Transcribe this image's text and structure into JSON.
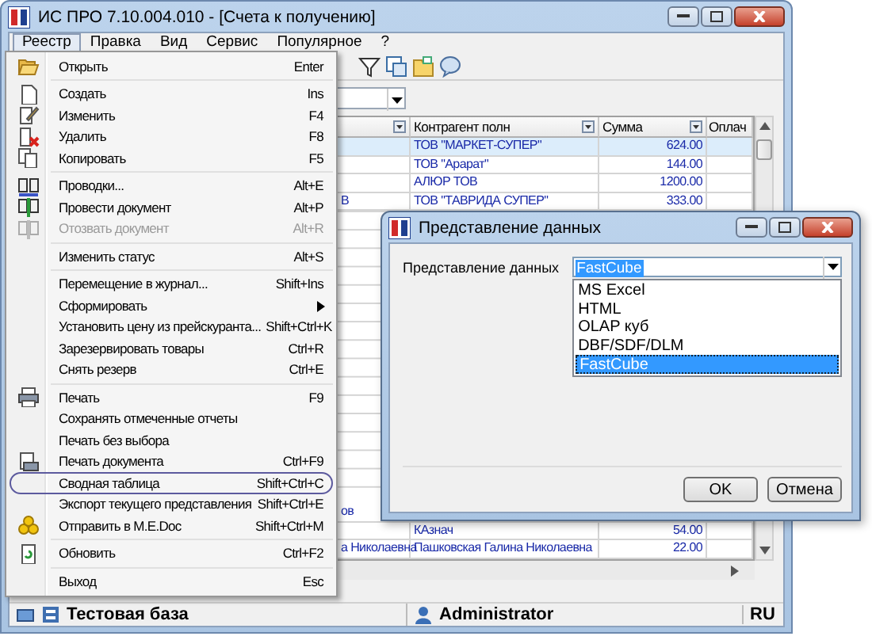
{
  "window": {
    "title": "ИС ПРО 7.10.004.010 - [Счета к получению]"
  },
  "menu_bar": [
    {
      "label": "Реестр",
      "selected": true
    },
    {
      "label": "Правка",
      "selected": false
    },
    {
      "label": "Вид",
      "selected": false
    },
    {
      "label": "Сервис",
      "selected": false
    },
    {
      "label": "Популярное",
      "selected": false
    },
    {
      "label": "?",
      "selected": false
    }
  ],
  "menu": [
    {
      "kind": "item",
      "label": "Открыть",
      "shortcut": "Enter",
      "disabled": false,
      "submenu": false,
      "circled": false
    },
    {
      "kind": "separator"
    },
    {
      "kind": "item",
      "label": "Создать",
      "shortcut": "Ins",
      "disabled": false,
      "submenu": false,
      "circled": false
    },
    {
      "kind": "item",
      "label": "Изменить",
      "shortcut": "F4",
      "disabled": false,
      "submenu": false,
      "circled": false
    },
    {
      "kind": "item",
      "label": "Удалить",
      "shortcut": "F8",
      "disabled": false,
      "submenu": false,
      "circled": false
    },
    {
      "kind": "item",
      "label": "Копировать",
      "shortcut": "F5",
      "disabled": false,
      "submenu": false,
      "circled": false
    },
    {
      "kind": "separator"
    },
    {
      "kind": "item",
      "label": "Проводки...",
      "shortcut": "Alt+E",
      "disabled": false,
      "submenu": false,
      "circled": false
    },
    {
      "kind": "item",
      "label": "Провести документ",
      "shortcut": "Alt+P",
      "disabled": false,
      "submenu": false,
      "circled": false
    },
    {
      "kind": "item",
      "label": "Отозвать документ",
      "shortcut": "Alt+R",
      "disabled": true,
      "submenu": false,
      "circled": false
    },
    {
      "kind": "separator"
    },
    {
      "kind": "item",
      "label": "Изменить статус",
      "shortcut": "Alt+S",
      "disabled": false,
      "submenu": false,
      "circled": false
    },
    {
      "kind": "separator"
    },
    {
      "kind": "item",
      "label": "Перемещение в журнал...",
      "shortcut": "Shift+Ins",
      "disabled": false,
      "submenu": false,
      "circled": false
    },
    {
      "kind": "item",
      "label": "Сформировать",
      "disabled": false,
      "submenu": true,
      "circled": false
    },
    {
      "kind": "item",
      "label": "Установить цену из прейскуранта...",
      "shortcut": "Shift+Ctrl+K",
      "disabled": false,
      "submenu": false,
      "circled": false
    },
    {
      "kind": "item",
      "label": "Зарезервировать товары",
      "shortcut": "Ctrl+R",
      "disabled": false,
      "submenu": false,
      "circled": false
    },
    {
      "kind": "item",
      "label": "Снять резерв",
      "shortcut": "Ctrl+E",
      "disabled": false,
      "submenu": false,
      "circled": false
    },
    {
      "kind": "separator"
    },
    {
      "kind": "item",
      "label": "Печать",
      "shortcut": "F9",
      "disabled": false,
      "submenu": false,
      "circled": false
    },
    {
      "kind": "item",
      "label": "Сохранять отмеченные отчеты",
      "disabled": false,
      "submenu": false,
      "circled": false
    },
    {
      "kind": "item",
      "label": "Печать без выбора",
      "disabled": false,
      "submenu": false,
      "circled": false
    },
    {
      "kind": "item",
      "label": "Печать документа",
      "shortcut": "Ctrl+F9",
      "disabled": false,
      "submenu": false,
      "circled": false
    },
    {
      "kind": "item",
      "label": "Сводная таблица",
      "shortcut": "Shift+Ctrl+C",
      "disabled": false,
      "submenu": false,
      "circled": true
    },
    {
      "kind": "item",
      "label": "Экспорт текущего представления",
      "shortcut": "Shift+Ctrl+E",
      "disabled": false,
      "submenu": false,
      "circled": false
    },
    {
      "kind": "item",
      "label": "Отправить в M.E.Doc",
      "shortcut": "Shift+Ctrl+M",
      "disabled": false,
      "submenu": false,
      "circled": false
    },
    {
      "kind": "separator"
    },
    {
      "kind": "item",
      "label": "Обновить",
      "shortcut": "Ctrl+F2",
      "disabled": false,
      "submenu": false,
      "circled": false
    },
    {
      "kind": "separator"
    },
    {
      "kind": "item",
      "label": "Выход",
      "shortcut": "Esc",
      "disabled": false,
      "submenu": false,
      "circled": false
    }
  ],
  "table": {
    "columns": [
      "",
      "Контрагент полн",
      "Сумма",
      "Оплач"
    ],
    "rows": [
      {
        "selected": true,
        "cells": [
          "",
          "ТОВ \"МАРКЕТ-СУПЕР\"",
          "624.00",
          ""
        ]
      },
      {
        "selected": false,
        "cells": [
          "",
          "ТОВ \"Арарат\"",
          "144.00",
          ""
        ]
      },
      {
        "selected": false,
        "cells": [
          "",
          "АЛЮР ТОВ",
          "1200.00",
          ""
        ]
      },
      {
        "selected": false,
        "cells": [
          "В",
          "ТОВ \"ТАВРИДА СУПЕР\"",
          "333.00",
          ""
        ]
      }
    ],
    "bottom_rows": [
      {
        "selected": false,
        "cells": [
          "ов",
          "",
          "",
          ""
        ]
      },
      {
        "selected": false,
        "cells": [
          "",
          "КАзнач",
          "54.00",
          ""
        ]
      },
      {
        "selected": false,
        "cells": [
          "а Николаевна",
          "Пашковская Галина Николаевна",
          "22.00",
          ""
        ]
      }
    ]
  },
  "status_bar": {
    "database": "Тестовая база",
    "user": "Administrator",
    "language": "RU"
  },
  "dialog": {
    "title": "Представление данных",
    "field_label": "Представление данных",
    "value": "FastCube",
    "options": [
      {
        "label": "MS Excel",
        "selected": false
      },
      {
        "label": "HTML",
        "selected": false
      },
      {
        "label": "OLAP куб",
        "selected": false
      },
      {
        "label": "DBF/SDF/DLM",
        "selected": false
      },
      {
        "label": "FastCube",
        "selected": true
      }
    ],
    "buttons": [
      "OK",
      "Отмена"
    ]
  }
}
